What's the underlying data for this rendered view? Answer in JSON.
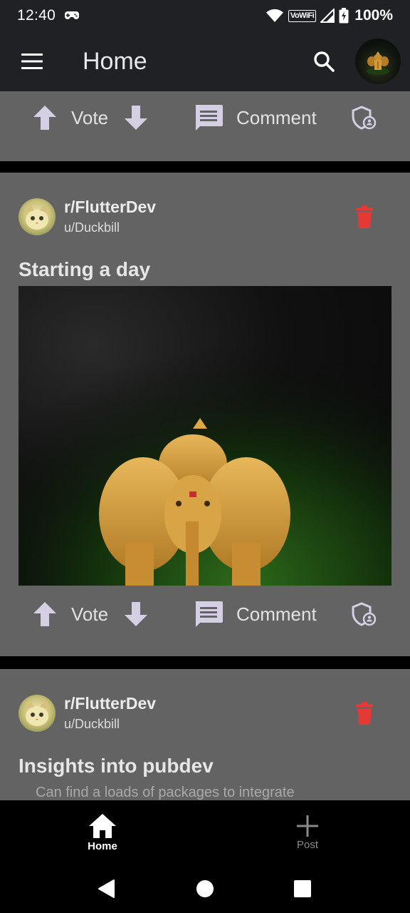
{
  "status_bar": {
    "time": "12:40",
    "wifi_label": "VoWiFi",
    "battery": "100%",
    "icons": [
      "gamepad-icon",
      "wifi-icon",
      "signal-icon",
      "battery-icon"
    ]
  },
  "app_bar": {
    "title": "Home",
    "icons": [
      "menu-icon",
      "search-icon"
    ]
  },
  "posts": [
    {
      "actions": {
        "vote": "Vote",
        "comment": "Comment"
      }
    },
    {
      "community": "r/FlutterDev",
      "user": "u/Duckbill",
      "title": "Starting a day",
      "actions": {
        "vote": "Vote",
        "comment": "Comment"
      }
    },
    {
      "community": "r/FlutterDev",
      "user": "u/Duckbill",
      "title": "Insights into pubdev",
      "description": "Can find a loads of packages to integrate"
    }
  ],
  "bottom_nav": {
    "items": [
      {
        "label": "Home",
        "icon": "home-icon",
        "active": true
      },
      {
        "label": "Post",
        "icon": "add-icon",
        "active": false
      }
    ]
  },
  "colors": {
    "app_bar": "#202124",
    "card": "#636363",
    "delete": "#e53935",
    "icon_tint": "#d4cfe3"
  }
}
